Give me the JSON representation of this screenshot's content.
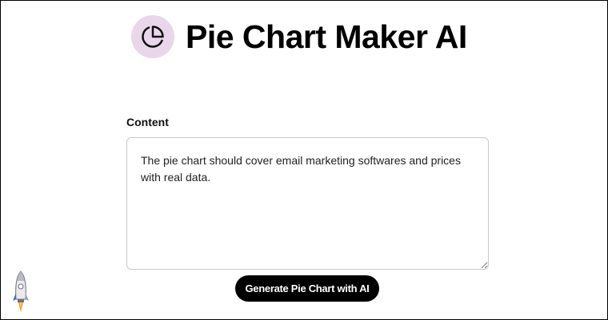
{
  "header": {
    "title": "Pie Chart Maker AI",
    "icon": "pie-chart-icon",
    "icon_bg_color": "#ead6ea"
  },
  "form": {
    "content_label": "Content",
    "content_value": "The pie chart should cover email marketing softwares and prices with real data.",
    "submit_label": "Generate Pie Chart with AI"
  },
  "widget": {
    "icon": "rocket-icon"
  }
}
